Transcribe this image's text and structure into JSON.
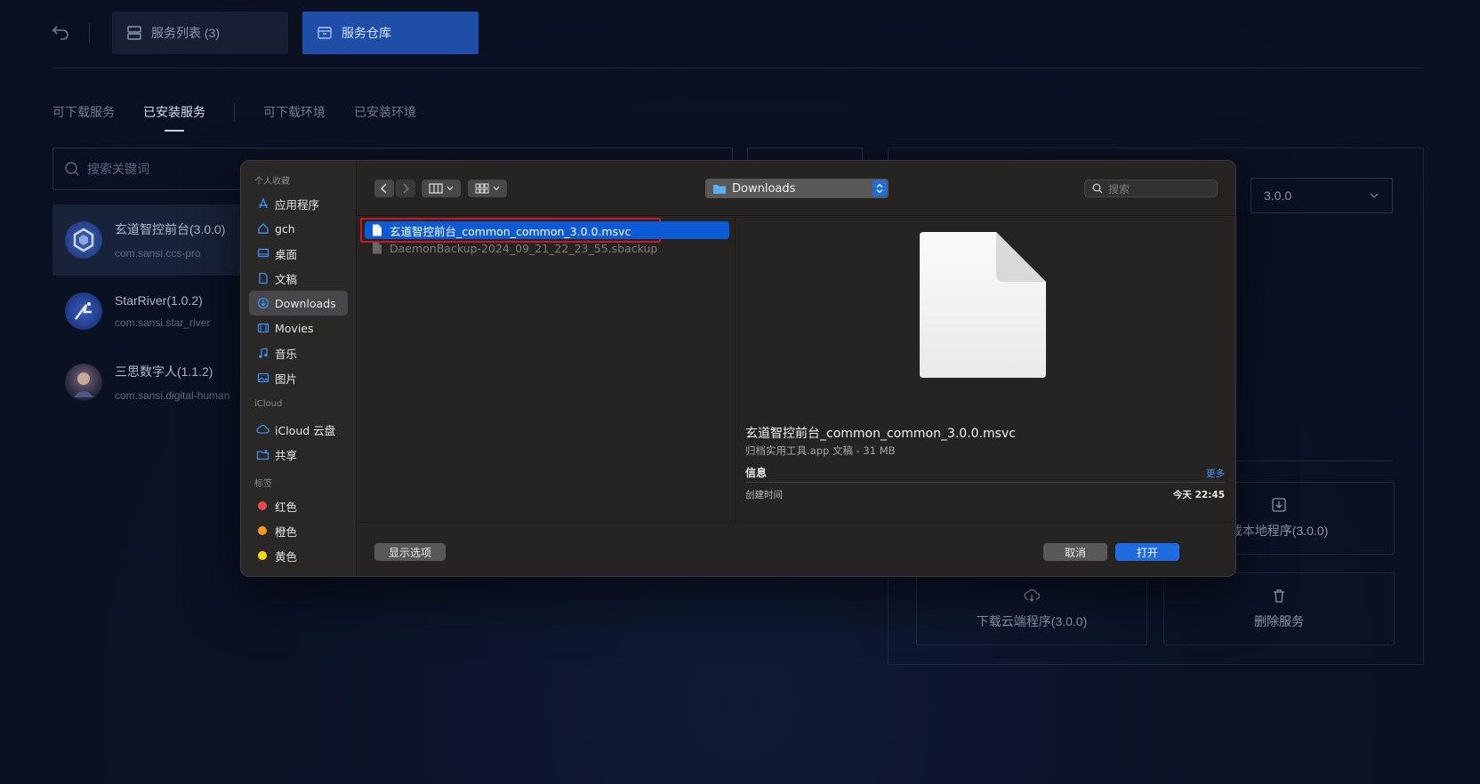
{
  "app": {
    "tabs": [
      {
        "label": "服务列表 (3)"
      },
      {
        "label": "服务仓库"
      }
    ],
    "subtabs": [
      "可下载服务",
      "已安装服务",
      "可下载环境",
      "已安装环境"
    ],
    "search_placeholder": "搜索关键词",
    "services": [
      {
        "name": "玄道智控前台(3.0.0)",
        "id": "com.sansi.ccs-pro"
      },
      {
        "name": "StarRiver(1.0.2)",
        "id": "com.sansi.star_river"
      },
      {
        "name": "三思数字人(1.1.2)",
        "id": "com.sansi.digital-human"
      }
    ],
    "version": "3.0.0",
    "actions": {
      "local": "载本地程序(3.0.0)",
      "cloud": "下载云端程序(3.0.0)",
      "delete": "删除服务"
    }
  },
  "dialog": {
    "sidebar": {
      "favorites_header": "个人收藏",
      "favorites": [
        {
          "label": "应用程序",
          "icon": "apps-icon"
        },
        {
          "label": "gch",
          "icon": "home-icon"
        },
        {
          "label": "桌面",
          "icon": "desktop-icon"
        },
        {
          "label": "文稿",
          "icon": "document-icon"
        },
        {
          "label": "Downloads",
          "icon": "downloads-icon",
          "selected": true
        },
        {
          "label": "Movies",
          "icon": "movies-icon"
        },
        {
          "label": "音乐",
          "icon": "music-icon"
        },
        {
          "label": "图片",
          "icon": "pictures-icon"
        }
      ],
      "icloud_header": "iCloud",
      "icloud": [
        {
          "label": "iCloud 云盘",
          "icon": "cloud-icon"
        },
        {
          "label": "共享",
          "icon": "shared-folder-icon"
        }
      ],
      "tags_header": "标签",
      "tags": [
        {
          "label": "红色",
          "color": "#e5484d"
        },
        {
          "label": "橙色",
          "color": "#f29a1f"
        },
        {
          "label": "黄色",
          "color": "#f5d90a"
        }
      ]
    },
    "location": "Downloads",
    "search_placeholder": "搜索",
    "files": [
      {
        "name": "玄道智控前台_common_common_3.0.0.msvc",
        "selected": true
      },
      {
        "name": "DaemonBackup-2024_09_21_22_23_55.sbackup",
        "selected": false
      }
    ],
    "preview": {
      "name": "玄道智控前台_common_common_3.0.0.msvc",
      "kind": "归档实用工具.app 文稿 - 31 MB",
      "info_label": "信息",
      "more_label": "更多",
      "created_key": "创建时间",
      "created_value": "今天 22:45"
    },
    "buttons": {
      "options": "显示选项",
      "cancel": "取消",
      "open": "打开"
    }
  }
}
